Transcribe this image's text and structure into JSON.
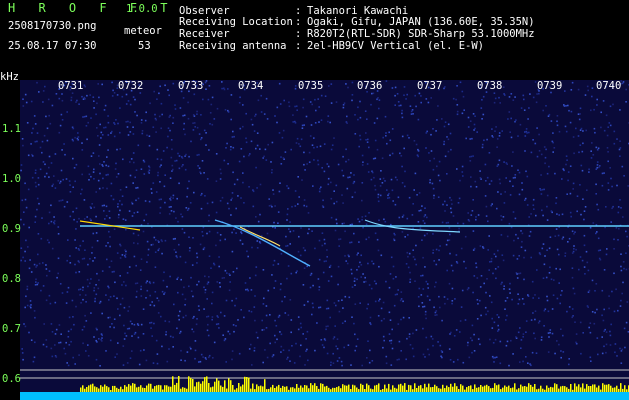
{
  "header": {
    "brand": "H R O F F T",
    "version": "1.0.0",
    "filename": "2508170730.png",
    "datetime": "25.08.17 07:30",
    "meteor_label": "meteor",
    "meteor_count": "53",
    "info": [
      {
        "key": "Observer",
        "value": "Takanori Kawachi"
      },
      {
        "key": "Receiving Location",
        "value": "Ogaki, Gifu, JAPAN (136.60E, 35.35N)"
      },
      {
        "key": "Receiver",
        "value": "R820T2(RTL-SDR) SDR-Sharp 53.1000MHz"
      },
      {
        "key": "Receiving antenna",
        "value": "2el-HB9CV Vertical (el. E-W)"
      }
    ]
  },
  "axis": {
    "y_unit": "kHz",
    "y_ticks": [
      "1.1",
      "1.0",
      "0.9",
      "0.8",
      "0.7",
      "0.6"
    ],
    "x_ticks": [
      "0731",
      "0732",
      "0733",
      "0734",
      "0735",
      "0736",
      "0737",
      "0738",
      "0739",
      "0740"
    ]
  },
  "colors": {
    "background": "#0a0a3a",
    "signal_line": "#60d0ff",
    "baseline": "#00bfff",
    "bursts": "#ffff00",
    "header_green": "#7cff5a"
  }
}
